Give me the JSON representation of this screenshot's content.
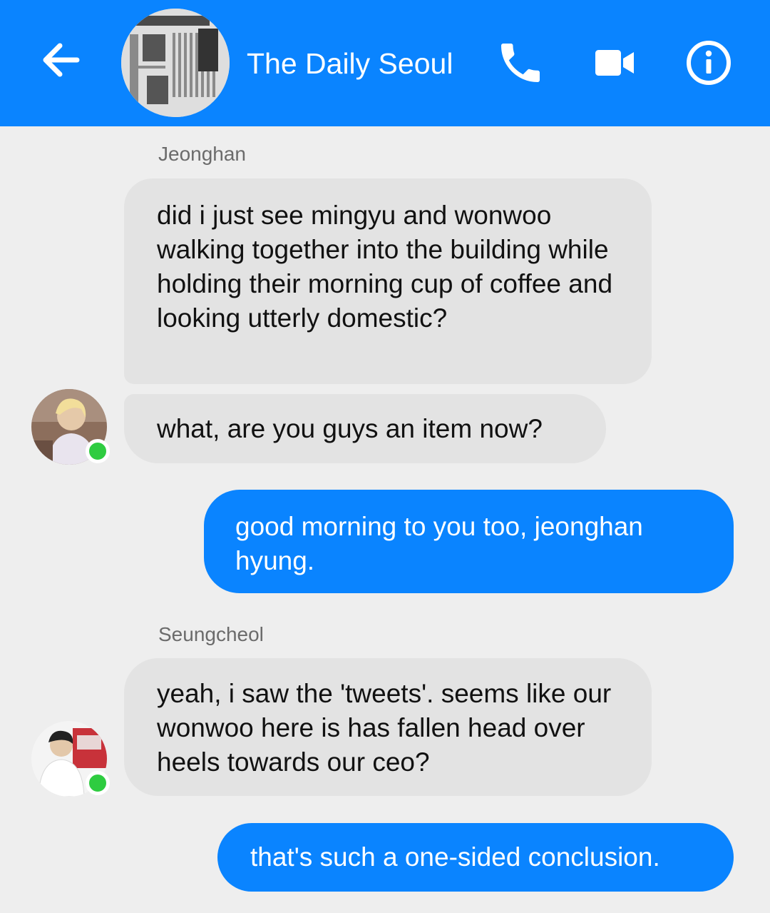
{
  "header": {
    "title": "The Daily Seoul",
    "back_icon": "arrow-left-icon",
    "call_icon": "phone-icon",
    "video_icon": "video-camera-icon",
    "info_icon": "info-icon",
    "accent": "#0a84ff"
  },
  "conversation": {
    "groups": [
      {
        "sender": "Jeonghan",
        "messages": [
          "did i just see mingyu and wonwoo walking together into the building while holding their morning cup of coffee and looking utterly domestic?",
          "what, are you guys an item now?"
        ]
      },
      {
        "sender": "me",
        "messages": [
          "good morning to you too, jeonghan hyung."
        ]
      },
      {
        "sender": "Seungcheol",
        "messages": [
          "yeah, i saw the 'tweets'. seems like our wonwoo here is has fallen head over heels towards our ceo?"
        ]
      },
      {
        "sender": "me",
        "messages": [
          "that's such a one-sided conclusion."
        ]
      }
    ]
  },
  "colors": {
    "incoming_bubble": "#e3e3e3",
    "outgoing_bubble": "#0a84ff",
    "online": "#2ecc40",
    "background": "#eeeeee"
  }
}
